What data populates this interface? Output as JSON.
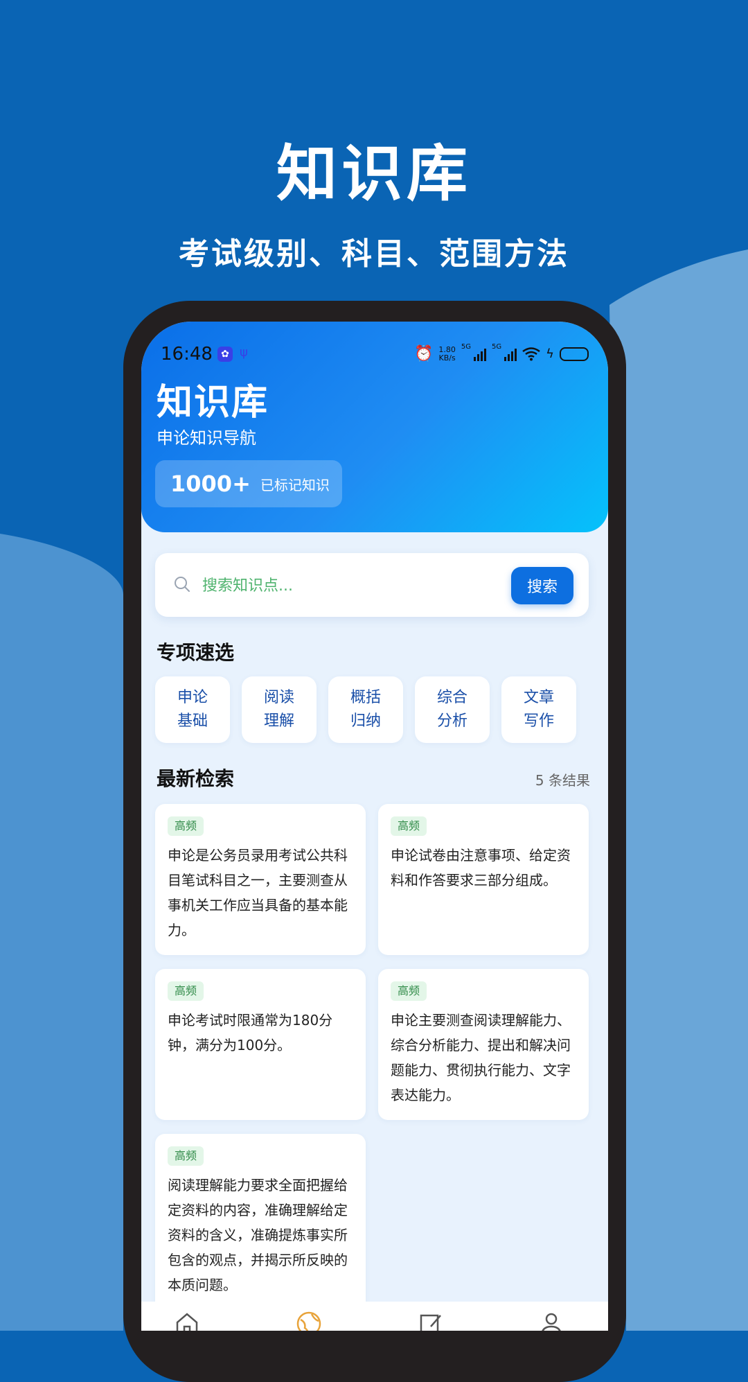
{
  "promo": {
    "title": "知识库",
    "subtitle": "考试级别、科目、范围方法"
  },
  "status_bar": {
    "time": "16:48",
    "net_speed_value": "1.80",
    "net_speed_unit": "KB/s",
    "sim1_label": "5G",
    "sim2_label": "5G"
  },
  "header": {
    "title": "知识库",
    "subtitle": "申论知识导航",
    "stat_number": "1000+",
    "stat_label": "已标记知识"
  },
  "search": {
    "placeholder": "搜索知识点...",
    "button_label": "搜索"
  },
  "quick_select": {
    "title": "专项速选",
    "items": [
      {
        "line1": "申论",
        "line2": "基础"
      },
      {
        "line1": "阅读",
        "line2": "理解"
      },
      {
        "line1": "概括",
        "line2": "归纳"
      },
      {
        "line1": "综合",
        "line2": "分析"
      },
      {
        "line1": "文章",
        "line2": "写作"
      }
    ]
  },
  "latest": {
    "title": "最新检索",
    "count_label": "5 条结果",
    "cards": [
      {
        "badge": "高频",
        "text": "申论是公务员录用考试公共科目笔试科目之一，主要测查从事机关工作应当具备的基本能力。"
      },
      {
        "badge": "高频",
        "text": "申论试卷由注意事项、给定资料和作答要求三部分组成。"
      },
      {
        "badge": "高频",
        "text": "申论考试时限通常为180分钟，满分为100分。"
      },
      {
        "badge": "高频",
        "text": "申论主要测查阅读理解能力、综合分析能力、提出和解决问题能力、贯彻执行能力、文字表达能力。"
      },
      {
        "badge": "高频",
        "text": "阅读理解能力要求全面把握给定资料的内容，准确理解给定资料的含义，准确提炼事实所包含的观点，并揭示所反映的本质问题。"
      }
    ]
  },
  "tabbar": {
    "icons": [
      "home-icon",
      "globe-icon",
      "edit-icon",
      "user-icon"
    ],
    "active_color": "#e8a33a"
  }
}
